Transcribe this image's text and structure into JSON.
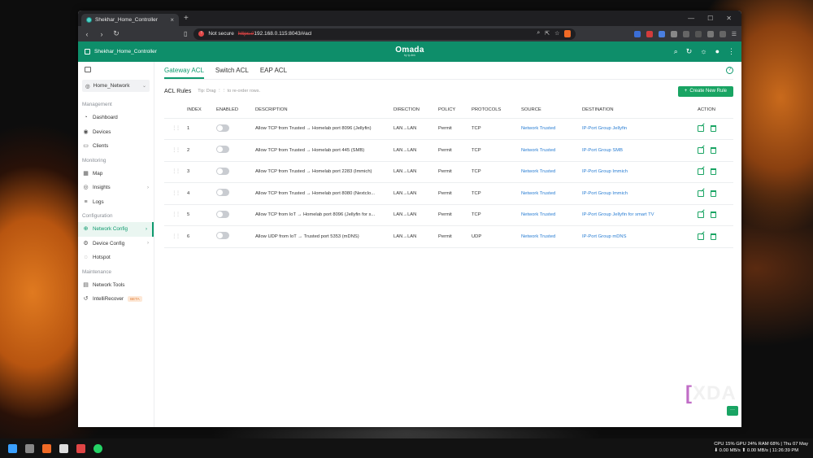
{
  "browser": {
    "tab_title": "Shekhar_Home_Controller",
    "not_secure": "Not secure",
    "url_scheme": "https://",
    "url_rest": "192.168.0.115:8043/#acl"
  },
  "header": {
    "site_name": "Shekhar_Home_Controller",
    "brand": "Omada",
    "brand_sub": "by tp-link"
  },
  "sidebar": {
    "site_select": "Home_Network",
    "sections": [
      {
        "title": "Management",
        "items": [
          "Dashboard",
          "Devices",
          "Clients"
        ]
      },
      {
        "title": "Monitoring",
        "items": [
          "Map",
          "Insights",
          "Logs"
        ]
      },
      {
        "title": "Configuration",
        "items": [
          "Network Config",
          "Device Config",
          "Hotspot"
        ]
      },
      {
        "title": "Maintenance",
        "items": [
          "Network Tools",
          "IntelliRecover"
        ]
      }
    ],
    "beta_badge": "BETA"
  },
  "main": {
    "tabs": [
      "Gateway ACL",
      "Switch ACL",
      "EAP ACL"
    ],
    "acl_title": "ACL Rules",
    "tip": "Tip: Drag ⋮⋮ to re-order rows.",
    "create_button": "Create New Rule",
    "columns": [
      "INDEX",
      "ENABLED",
      "DESCRIPTION",
      "DIRECTION",
      "POLICY",
      "PROTOCOLS",
      "SOURCE",
      "DESTINATION",
      "ACTION"
    ],
    "rows": [
      {
        "index": "1",
        "description": "Allow TCP from Trusted → Homelab port 8096 (Jellyfin)",
        "direction": "LAN→LAN",
        "policy": "Permit",
        "protocol": "TCP",
        "source": "Network Trusted",
        "destination": "IP-Port Group Jellyfin"
      },
      {
        "index": "2",
        "description": "Allow TCP from Trusted → Homelab port 445 (SMB)",
        "direction": "LAN→LAN",
        "policy": "Permit",
        "protocol": "TCP",
        "source": "Network Trusted",
        "destination": "IP-Port Group SMB"
      },
      {
        "index": "3",
        "description": "Allow TCP from Trusted → Homelab port 2283 (Immich)",
        "direction": "LAN→LAN",
        "policy": "Permit",
        "protocol": "TCP",
        "source": "Network Trusted",
        "destination": "IP-Port Group Immich"
      },
      {
        "index": "4",
        "description": "Allow TCP from Trusted → Homelab port 8080 (Nextclo...",
        "direction": "LAN→LAN",
        "policy": "Permit",
        "protocol": "TCP",
        "source": "Network Trusted",
        "destination": "IP-Port Group Immich"
      },
      {
        "index": "5",
        "description": "Allow TCP from IoT → Homelab port 8096 (Jellyfin for s...",
        "direction": "LAN→LAN",
        "policy": "Permit",
        "protocol": "TCP",
        "source": "Network Trusted",
        "destination": "IP-Port Group Jellyfin for smart TV"
      },
      {
        "index": "6",
        "description": "Allow UDP from IoT → Trusted port 5353 (mDNS)",
        "direction": "LAN→LAN",
        "policy": "Permit",
        "protocol": "UDP",
        "source": "Network Trusted",
        "destination": "IP-Port Group mDNS"
      }
    ]
  },
  "watermark": "XDA",
  "taskbar": {
    "stats_line1": "CPU 15% GPU 24% RAM 68% | Thu 07 May",
    "stats_line2": "⬇ 0.00 MB/s ⬆ 0.00 MB/s | 11:26:39 PM"
  },
  "colors": {
    "accent": "#0e9a6e",
    "header": "#0e8e6a",
    "link": "#2a7ed3"
  }
}
